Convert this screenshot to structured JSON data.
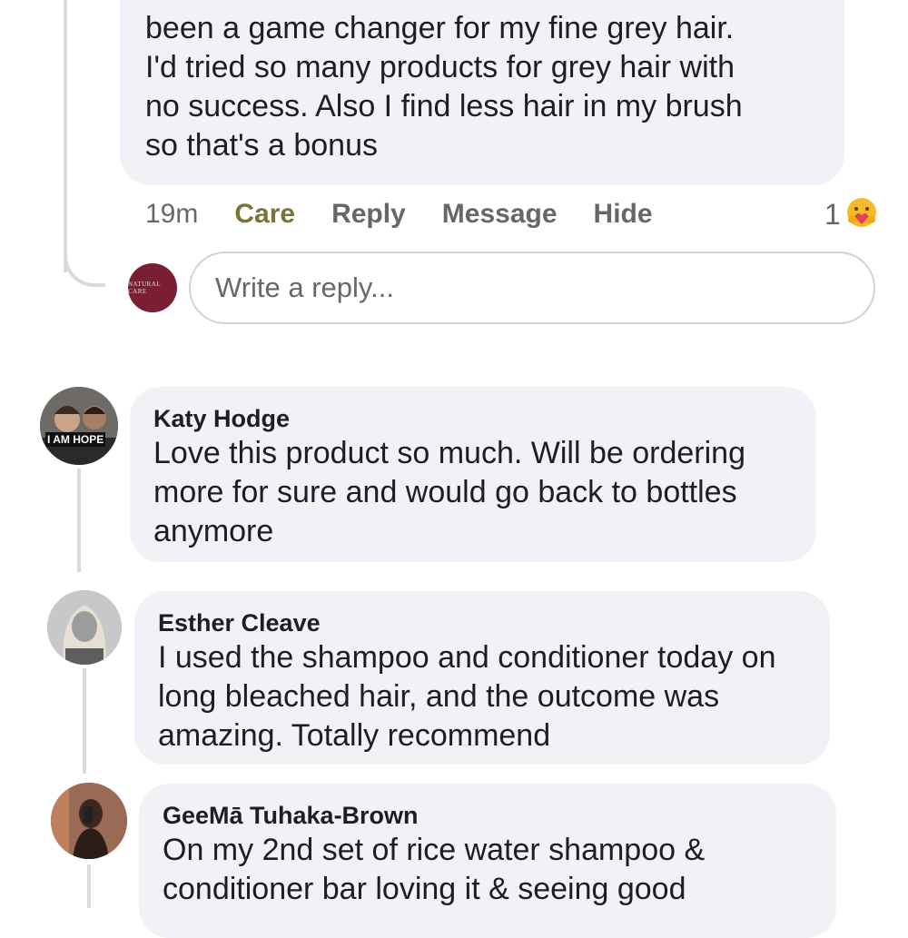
{
  "comment_top": {
    "text_lines": [
      "been a game changer for my fine grey hair.",
      "I'd tried so many products for grey hair with",
      "no success. Also I find less hair in my brush",
      "so that's a bonus"
    ],
    "actions": {
      "time": "19m",
      "care": "Care",
      "reply": "Reply",
      "message": "Message",
      "hide": "Hide"
    },
    "reaction_count": "1",
    "reaction_icon": "care-emoji-icon"
  },
  "reply_box": {
    "placeholder": "Write a reply...",
    "avatar_text": "NATURAL CARE",
    "avatar_color": "#7a1f33"
  },
  "comments": [
    {
      "name": "Katy Hodge",
      "text_lines": [
        "Love this product so much.  Will be ordering",
        "more for sure and would go back to bottles",
        "anymore"
      ],
      "avatar_text": "I AM HOPE"
    },
    {
      "name": "Esther Cleave",
      "text_lines": [
        "I used the shampoo and conditioner today on",
        "long bleached hair, and the outcome was",
        "amazing. Totally recommend"
      ]
    },
    {
      "name": "GeeMā Tuhaka-Brown",
      "text_lines": [
        "On my 2nd set of rice water shampoo &",
        "conditioner bar loving it & seeing good"
      ]
    }
  ],
  "colors": {
    "bubble": "#f0f2f5",
    "care_text": "#7a7338",
    "action_text": "#65676b"
  }
}
